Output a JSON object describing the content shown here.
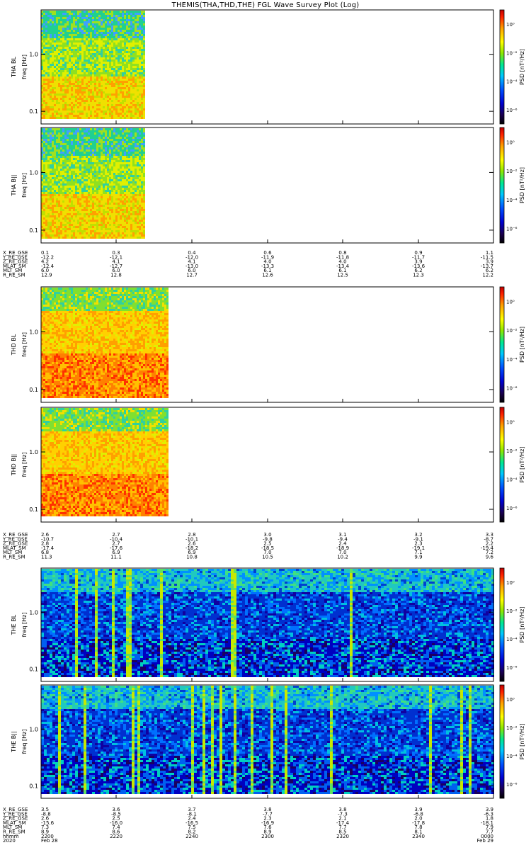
{
  "title": "THEMIS(THA,THD,THE) FGL Wave Survey Plot (Log)",
  "freq_label": "freq [Hz]",
  "psd_label": "PSD [nT²/Hz]",
  "colorbar_ticks": [
    "10⁰",
    "10⁻²",
    "10⁻⁴",
    "10⁻⁶"
  ],
  "colorbar_tick_values": [
    0,
    -2,
    -4,
    -6
  ],
  "ylim": [
    0.06,
    6
  ],
  "yticks": [
    {
      "v": 1.0,
      "label": "1.0"
    },
    {
      "v": 0.1,
      "label": "0.1"
    }
  ],
  "panels": [
    {
      "name": "tha-bl",
      "ylabel": "THA BL",
      "fill_frac": 0.23,
      "style": "tha"
    },
    {
      "name": "tha-bll",
      "ylabel": "THA B||",
      "fill_frac": 0.23,
      "style": "tha"
    },
    {
      "name": "thd-bl",
      "ylabel": "THD BL",
      "fill_frac": 0.28,
      "style": "thd"
    },
    {
      "name": "thd-bll",
      "ylabel": "THD B||",
      "fill_frac": 0.28,
      "style": "thd"
    },
    {
      "name": "the-bl",
      "ylabel": "THE BL",
      "fill_frac": 1.0,
      "style": "the"
    },
    {
      "name": "the-bll",
      "ylabel": "THE B||",
      "fill_frac": 1.0,
      "style": "the"
    }
  ],
  "ephem": [
    {
      "labels": [
        "X_RE_GSE",
        "Y_RE_GSE",
        "Z_RE_GSE",
        "MLAT_SM",
        "MLT_SM",
        "R_RE_SM"
      ],
      "rows": [
        [
          "0.1",
          "0.3",
          "0.4",
          "0.6",
          "0.8",
          "0.9",
          "1.1"
        ],
        [
          "-12.2",
          "-12.1",
          "-12.0",
          "-11.9",
          "-11.8",
          "-11.7",
          "-11.5"
        ],
        [
          "4.2",
          "4.1",
          "4.1",
          "4.0",
          "4.0",
          "3.9",
          "3.9"
        ],
        [
          "-12.4",
          "-12.7",
          "-13.0",
          "-13.3",
          "-13.4",
          "-13.6",
          "-13.7"
        ],
        [
          "6.0",
          "6.0",
          "6.0",
          "6.1",
          "6.1",
          "6.2",
          "6.2"
        ],
        [
          "12.9",
          "12.8",
          "12.7",
          "12.6",
          "12.5",
          "12.3",
          "12.2"
        ]
      ]
    },
    {
      "labels": [
        "X_RE_GSE",
        "Y_RE_GSE",
        "Z_RE_GSE",
        "MLAT_SM",
        "MLT_SM",
        "R_RE_SM"
      ],
      "rows": [
        [
          "2.6",
          "2.7",
          "2.8",
          "3.0",
          "3.1",
          "3.2",
          "3.3"
        ],
        [
          "-10.7",
          "-10.4",
          "-10.1",
          "-9.8",
          "-9.4",
          "-9.1",
          "-8.7"
        ],
        [
          "2.8",
          "2.7",
          "2.6",
          "2.5",
          "2.4",
          "2.3",
          "2.2"
        ],
        [
          "-17.4",
          "-17.6",
          "-18.2",
          "-18.5",
          "-18.9",
          "-19.1",
          "-19.4"
        ],
        [
          "6.8",
          "6.9",
          "6.9",
          "7.0",
          "7.0",
          "7.1",
          "7.2"
        ],
        [
          "11.3",
          "11.1",
          "10.8",
          "10.5",
          "10.2",
          "9.9",
          "9.6"
        ]
      ]
    },
    {
      "labels": [
        "X_RE_GSE",
        "Y_RE_GSE",
        "Z_RE_GSE",
        "MLAT_SM",
        "MLT_SM",
        "R_RE_SM",
        "hhmm",
        "2020"
      ],
      "rows": [
        [
          "3.5",
          "3.6",
          "3.7",
          "3.8",
          "3.8",
          "3.9",
          "3.9"
        ],
        [
          "-8.8",
          "-8.5",
          "-8.1",
          "-7.7",
          "-7.3",
          "-6.8",
          "-6.3"
        ],
        [
          "2.6",
          "2.5",
          "2.4",
          "2.3",
          "2.1",
          "2.0",
          "1.8"
        ],
        [
          "-15.6",
          "-16.0",
          "-16.5",
          "-16.9",
          "-17.4",
          "-17.8",
          "-18.1"
        ],
        [
          "7.3",
          "7.4",
          "7.5",
          "7.6",
          "7.7",
          "7.8",
          "7.9"
        ],
        [
          "8.9",
          "8.6",
          "8.2",
          "8.9",
          "8.5",
          "8.1",
          "7.7"
        ],
        [
          "2200",
          "2220",
          "2240",
          "2300",
          "2320",
          "2340",
          "0000"
        ],
        [
          "Feb 28",
          "",
          "",
          "",
          "",
          "",
          "Feb 29"
        ]
      ]
    }
  ],
  "chart_data": {
    "type": "heatmap",
    "title": "THEMIS(THA,THD,THE) FGL Wave Survey Plot (Log)",
    "xlabel": "hhmm",
    "ylabel": "freq [Hz]",
    "ylim": [
      0.06,
      6
    ],
    "zlabel": "PSD [nT²/Hz]",
    "zlim_log10": [
      -7,
      1
    ],
    "x_ticks": [
      "2200",
      "2220",
      "2240",
      "2300",
      "2320",
      "2340",
      "0000"
    ],
    "series": [
      {
        "name": "THA BL"
      },
      {
        "name": "THA B||"
      },
      {
        "name": "THD BL"
      },
      {
        "name": "THD B||"
      },
      {
        "name": "THE BL"
      },
      {
        "name": "THE B||"
      }
    ]
  }
}
